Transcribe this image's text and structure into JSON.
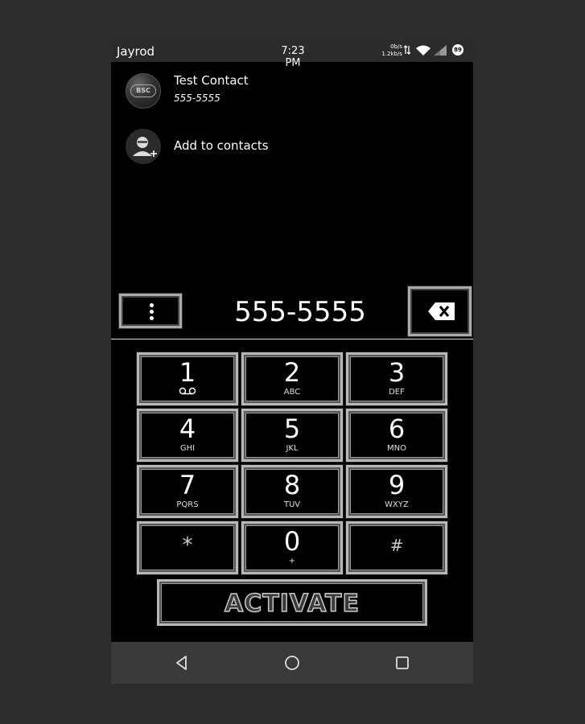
{
  "status_bar": {
    "carrier": "Jayrod",
    "time": "7:23 PM",
    "net_up": "0b/s",
    "net_down": "1.2kb/s",
    "battery": "89",
    "icons": [
      "data-arrows-icon",
      "wifi-icon",
      "signal-icon",
      "battery-icon"
    ]
  },
  "contacts": [
    {
      "name": "Test Contact",
      "number": "555-5555",
      "avatar_text": "BSC"
    }
  ],
  "add_to_contacts": {
    "label": "Add to contacts"
  },
  "dialer": {
    "digits": "555-5555"
  },
  "keypad": {
    "keys": [
      {
        "digit": "1",
        "letters": ""
      },
      {
        "digit": "2",
        "letters": "ABC"
      },
      {
        "digit": "3",
        "letters": "DEF"
      },
      {
        "digit": "4",
        "letters": "GHI"
      },
      {
        "digit": "5",
        "letters": "JKL"
      },
      {
        "digit": "6",
        "letters": "MNO"
      },
      {
        "digit": "7",
        "letters": "PQRS"
      },
      {
        "digit": "8",
        "letters": "TUV"
      },
      {
        "digit": "9",
        "letters": "WXYZ"
      },
      {
        "digit": "*",
        "letters": ""
      },
      {
        "digit": "0",
        "letters": "+"
      },
      {
        "digit": "#",
        "letters": ""
      }
    ]
  },
  "activate_button": {
    "label": "ACTIVATE"
  },
  "navigation": {
    "items": [
      "back-icon",
      "home-icon",
      "recents-icon"
    ]
  }
}
